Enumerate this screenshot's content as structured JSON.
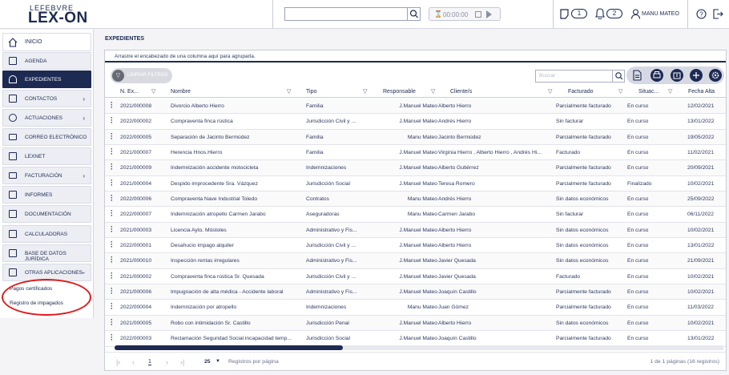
{
  "brand": {
    "top": "LEFEBVRE",
    "main": "LEX-ON"
  },
  "header": {
    "search_placeholder": "",
    "timer": "00:00:00",
    "notes_count": "1",
    "alerts_count": "2",
    "user": "MANU MATEO"
  },
  "sidebar": {
    "items": [
      {
        "label": "INICIO",
        "icon": "home-icon"
      },
      {
        "label": "AGENDA",
        "icon": "calendar-icon"
      },
      {
        "label": "EXPEDIENTES",
        "icon": "scales-icon"
      },
      {
        "label": "CONTACTOS",
        "icon": "contact-card-icon"
      },
      {
        "label": "ACTUACIONES",
        "icon": "clock-icon"
      },
      {
        "label": "CORREO ELECTRÓNICO",
        "icon": "mail-icon"
      },
      {
        "label": "LEXNET",
        "icon": "lexnet-icon"
      },
      {
        "label": "FACTURACIÓN",
        "icon": "invoice-icon"
      },
      {
        "label": "INFORMES",
        "icon": "report-icon"
      },
      {
        "label": "DOCUMENTACIÓN",
        "icon": "document-icon"
      },
      {
        "label": "CALCULADORAS",
        "icon": "calculator-icon"
      },
      {
        "label": "BASE DE DATOS JURÍDICA",
        "icon": "database-icon"
      },
      {
        "label": "OTRAS APLICACIONES",
        "icon": "external-icon"
      }
    ],
    "subitems": [
      "Pagos certificados",
      "Registro de impagados"
    ]
  },
  "main": {
    "title": "EXPEDIENTES",
    "group_hint": "Arrastre el encabezado de una columna aquí para agruparla.",
    "clear_filters": "LIMPIAR FILTROS",
    "search_placeholder": "Buscar",
    "columns": [
      "N. Ex...",
      "Nombre",
      "Tipo",
      "Responsable",
      "Cliente/s",
      "Facturado",
      "Situac...",
      "Fecha Alta"
    ],
    "rows": [
      [
        "2021/000008",
        "Divorcio Alberto Hierro",
        "Familia",
        "J.Manuel Mateo",
        "Alberto Hierro",
        "Parcialmente facturado",
        "En curso",
        "12/02/2021"
      ],
      [
        "2022/000002",
        "Compraventa finca rústica",
        "Jurisdicción Civil y ...",
        "J.Manuel Mateo",
        "Andrés Hierro",
        "Sin facturar",
        "En curso",
        "13/01/2022"
      ],
      [
        "2022/000005",
        "Separación de Jacinto Bermúdez",
        "Familia",
        "Manu Mateo",
        "Jacinto Bermúdez",
        "Parcialmente facturado",
        "En curso",
        "19/05/2022"
      ],
      [
        "2021/000007",
        "Herencia Hnos.Hierro",
        "Familia",
        "J.Manuel Mateo",
        "Virginia Hierro , Alberto Hierro , Andrés Hi...",
        "Facturado",
        "En curso",
        "11/02/2021"
      ],
      [
        "2021/000009",
        "Indemnización accidente motocicleta",
        "Indemnizaciones",
        "J.Manuel Mateo",
        "Alberto Gutiérrez",
        "Parcialmente facturado",
        "En curso",
        "20/09/2021"
      ],
      [
        "2021/000004",
        "Despido improcedente Sra. Vázquez",
        "Jurisdicción Social",
        "J.Manuel Mateo",
        "Teresa Romero",
        "Parcialmente facturado",
        "Finalizado",
        "10/02/2021"
      ],
      [
        "2022/000006",
        "Compraventa Nave Industrial Toledo",
        "Contratos",
        "Manu Mateo",
        "Andrés Hierro",
        "Sin datos económicos",
        "En curso",
        "25/09/2022"
      ],
      [
        "2022/000007",
        "Indemnización atropello Carmen Jarabo",
        "Aseguradoras",
        "Manu Mateo",
        "Carmen Jarabo",
        "Sin facturar",
        "En curso",
        "06/11/2022"
      ],
      [
        "2021/000003",
        "Licencia Ayto. Móstoles",
        "Administrativo y Fis...",
        "J.Manuel Mateo",
        "Alberto Hierro",
        "Sin datos económicos",
        "En curso",
        "10/02/2021"
      ],
      [
        "2022/000001",
        "Desahucio impago alquiler",
        "Jurisdicción Civil y ...",
        "J.Manuel Mateo",
        "Alberto Hierro",
        "Sin datos económicos",
        "En curso",
        "13/01/2022"
      ],
      [
        "2021/000010",
        "Inspección rentas irregulares",
        "Administrativo y Fis...",
        "J.Manuel Mateo",
        "Javier Quesada",
        "Sin datos económicos",
        "En curso",
        "21/09/2021"
      ],
      [
        "2021/000002",
        "Compraventa finca rústica Sr. Quesada",
        "Jurisdicción Civil y ...",
        "J.Manuel Mateo",
        "Javier Quesada",
        "Facturado",
        "En curso",
        "10/02/2021"
      ],
      [
        "2021/000006",
        "Impugnación de alta médica - Accidente laboral",
        "Administrativo y Fis...",
        "J.Manuel Mateo",
        "Joaquín Castillo",
        "Parcialmente facturado",
        "En curso",
        "10/02/2021"
      ],
      [
        "2022/000004",
        "Indemnización por atropello",
        "Indemnizaciones",
        "Manu Mateo",
        "Juan Gómez",
        "Parcialmente facturado",
        "En curso",
        "11/03/2022"
      ],
      [
        "2021/000005",
        "Robo con intimidación Sr. Castillo",
        "Jurisdicción Penal",
        "J.Manuel Mateo",
        "Alberto Hierro",
        "Sin datos económicos",
        "En curso",
        "10/02/2021"
      ],
      [
        "2022/000003",
        "Reclamación Seguridad Social incapacidad temp...",
        "Jurisdicción Social",
        "J.Manuel Mateo",
        "Joaquín Castillo",
        "Parcialmente facturado",
        "En curso",
        "13/01/2022"
      ]
    ],
    "pager": {
      "current_page": "1",
      "page_size": "25",
      "page_size_label": "Registros por página",
      "info": "1 de 1 páginas (16 registros)"
    }
  },
  "colors": {
    "navy": "#1d2a52",
    "annotation": "#e01b1b"
  }
}
